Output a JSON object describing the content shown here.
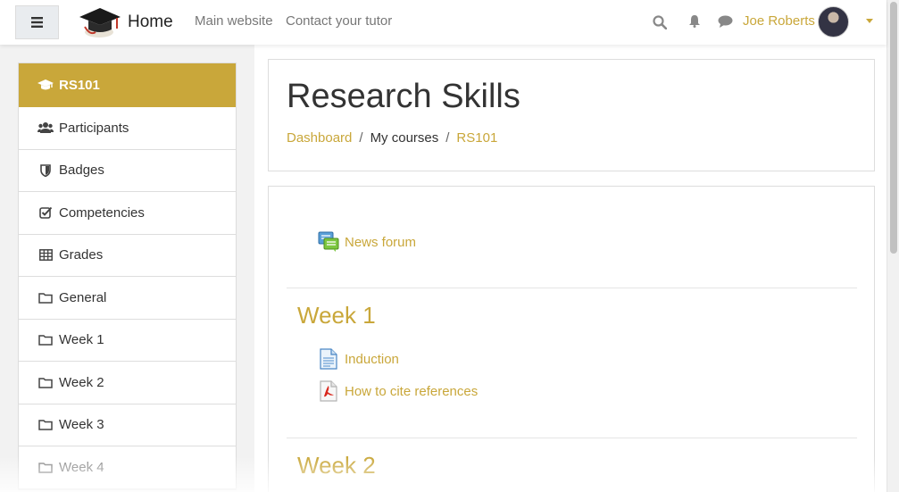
{
  "navbar": {
    "brand": "Home",
    "links": [
      "Main website",
      "Contact your tutor"
    ],
    "user_name": "Joe Roberts"
  },
  "sidebar": {
    "items": [
      {
        "label": "RS101",
        "icon": "graduation-cap-icon",
        "active": true
      },
      {
        "label": "Participants",
        "icon": "users-icon"
      },
      {
        "label": "Badges",
        "icon": "shield-icon"
      },
      {
        "label": "Competencies",
        "icon": "checkbox-icon"
      },
      {
        "label": "Grades",
        "icon": "table-icon"
      },
      {
        "label": "General",
        "icon": "folder-icon"
      },
      {
        "label": "Week 1",
        "icon": "folder-icon"
      },
      {
        "label": "Week 2",
        "icon": "folder-icon"
      },
      {
        "label": "Week 3",
        "icon": "folder-icon"
      },
      {
        "label": "Week 4",
        "icon": "folder-icon"
      }
    ]
  },
  "page": {
    "title": "Research Skills",
    "breadcrumb": [
      "Dashboard",
      "My courses",
      "RS101"
    ]
  },
  "course": {
    "news_forum": "News forum",
    "sections": [
      {
        "title": "Week 1",
        "activities": [
          "Induction",
          "How to cite references"
        ]
      },
      {
        "title": "Week 2"
      }
    ]
  },
  "colors": {
    "accent": "#c9a73a"
  }
}
